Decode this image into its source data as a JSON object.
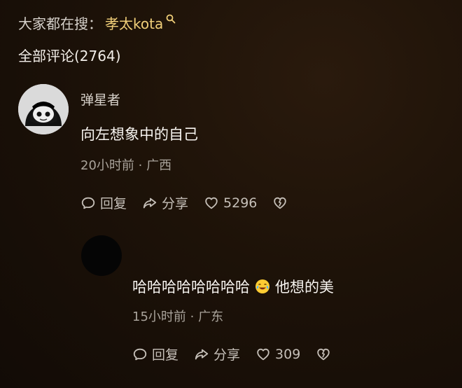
{
  "search_hint": {
    "label": "大家都在搜：",
    "term": "孝太kota"
  },
  "comments_header": {
    "title": "全部评论(2764)"
  },
  "comments": [
    {
      "username": "弹星者",
      "text": "向左想象中的自己",
      "time_location": "20小时前 · 广西",
      "reply_label": "回复",
      "share_label": "分享",
      "like_count": "5296"
    },
    {
      "text_before": "哈哈哈哈哈哈哈哈",
      "text_after": "他想的美",
      "time_location": "15小时前 · 广东",
      "reply_label": "回复",
      "share_label": "分享",
      "like_count": "309"
    }
  ],
  "icons": {
    "search_mini": "search-icon",
    "reply": "comment-bubble-icon",
    "share": "share-arrow-icon",
    "like": "heart-icon",
    "dislike": "broken-heart-icon",
    "emoji": "crying-laughing-emoji-icon"
  }
}
